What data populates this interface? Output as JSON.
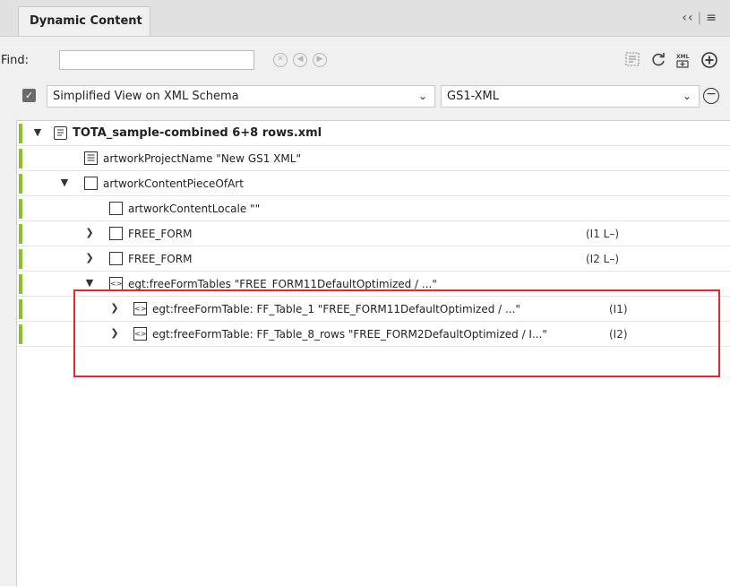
{
  "panel": {
    "tab_label": "Dynamic Content",
    "collapse_glyph": "‹‹",
    "menu_glyph": "≡"
  },
  "find": {
    "label": "Find:",
    "value": "",
    "placeholder": ""
  },
  "toolbar": {
    "icons": [
      "clear-icon",
      "previous-icon",
      "next-icon",
      "select-icon",
      "refresh-icon",
      "xml-add-icon",
      "add-icon"
    ]
  },
  "schema": {
    "checked": true,
    "view_label": "Simplified View on XML Schema",
    "format_label": "GS1-XML"
  },
  "tree": {
    "rows": [
      {
        "label": "TOTA_sample-combined 6+8 rows.xml",
        "suffix": ""
      },
      {
        "label": "artworkProjectName  \"New GS1 XML\"",
        "suffix": ""
      },
      {
        "label": "artworkContentPieceOfArt",
        "suffix": ""
      },
      {
        "label": "artworkContentLocale  \"\"",
        "suffix": ""
      },
      {
        "label": "FREE_FORM",
        "suffix": "(I1 L–)"
      },
      {
        "label": "FREE_FORM",
        "suffix": "(I2 L–)"
      },
      {
        "label": "egt:freeFormTables  \"FREE_FORM11DefaultOptimized / ...\"",
        "suffix": ""
      },
      {
        "label": "egt:freeFormTable: FF_Table_1  \"FREE_FORM11DefaultOptimized / ...\"",
        "suffix": "(I1)"
      },
      {
        "label": "egt:freeFormTable: FF_Table_8_rows  \"FREE_FORM2DefaultOptimized / I...\"",
        "suffix": "(I2)"
      }
    ]
  },
  "colors": {
    "status_bar": "#8bbf2e",
    "highlight": "#e0282f"
  }
}
